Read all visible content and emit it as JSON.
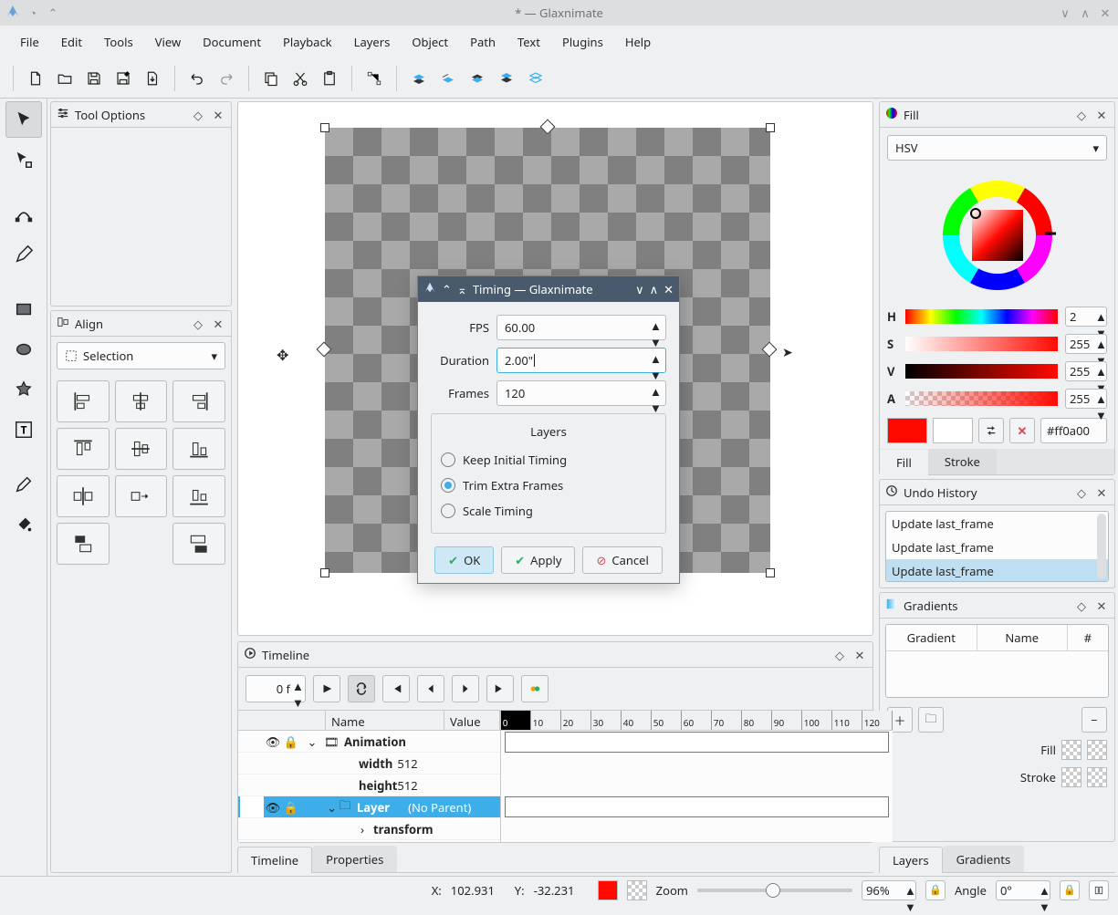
{
  "window": {
    "title": "* — Glaxnimate"
  },
  "menubar": [
    "File",
    "Edit",
    "Tools",
    "View",
    "Document",
    "Playback",
    "Layers",
    "Object",
    "Path",
    "Text",
    "Plugins",
    "Help"
  ],
  "panels": {
    "toolOptions": {
      "title": "Tool Options"
    },
    "align": {
      "title": "Align",
      "select_label": "Selection"
    },
    "fill": {
      "title": "Fill",
      "mode": "HSV",
      "H": "2",
      "S": "255",
      "V": "255",
      "A": "255",
      "hex": "#ff0a00",
      "tab_fill": "Fill",
      "tab_stroke": "Stroke"
    },
    "undo": {
      "title": "Undo History",
      "items": [
        "Update last_frame",
        "Update last_frame",
        "Update last_frame"
      ],
      "selected": 2
    },
    "gradients": {
      "title": "Gradients",
      "cols": [
        "Gradient",
        "Name",
        "#"
      ],
      "fill_label": "Fill",
      "stroke_label": "Stroke"
    },
    "timeline": {
      "title": "Timeline",
      "frame": "0 f"
    }
  },
  "dialog": {
    "title": "Timing — Glaxnimate",
    "fps_label": "FPS",
    "fps": "60.00",
    "duration_label": "Duration",
    "duration": "2.00\"",
    "frames_label": "Frames",
    "frames": "120",
    "group_label": "Layers",
    "radio_keep": "Keep Initial Timing",
    "radio_trim": "Trim Extra Frames",
    "radio_scale": "Scale Timing",
    "selected_radio": "trim",
    "ok": "OK",
    "apply": "Apply",
    "cancel": "Cancel"
  },
  "timeline_table": {
    "head_name": "Name",
    "head_value": "Value",
    "rows": [
      {
        "name": "Animation",
        "value": "",
        "icon": "film"
      },
      {
        "name": "width",
        "value": "512"
      },
      {
        "name": "height",
        "value": "512"
      },
      {
        "name": "Layer",
        "value": "(No Parent)",
        "sel": true
      },
      {
        "name": "transform",
        "value": ""
      }
    ],
    "ruler": [
      "0",
      "10",
      "20",
      "30",
      "40",
      "50",
      "60",
      "70",
      "80",
      "90",
      "100",
      "110",
      "120"
    ]
  },
  "bottom_tabs": {
    "timeline": "Timeline",
    "properties": "Properties"
  },
  "right_bottom_tabs": {
    "layers": "Layers",
    "gradients": "Gradients"
  },
  "statusbar": {
    "x_label": "X:",
    "x": "102.931",
    "y_label": "Y:",
    "y": "-32.231",
    "zoom_label": "Zoom",
    "zoom": "96%",
    "angle_label": "Angle",
    "angle": "0°"
  }
}
